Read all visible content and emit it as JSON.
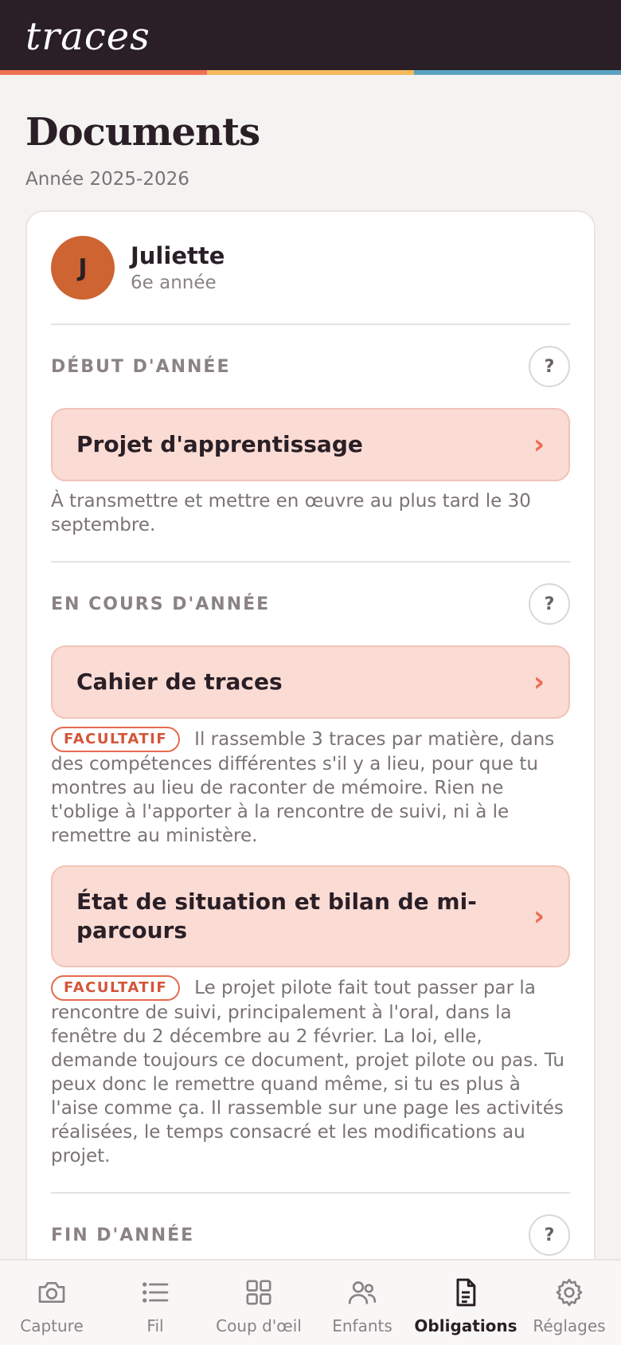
{
  "header": {
    "logo": "traces"
  },
  "page": {
    "title": "Documents",
    "subtitle": "Année 2025-2026"
  },
  "child": {
    "initial": "J",
    "name": "Juliette",
    "grade": "6e année"
  },
  "sections": [
    {
      "title": "DÉBUT D'ANNÉE",
      "items": [
        {
          "label": "Projet d'apprentissage",
          "badge": "",
          "description": "À transmettre et mettre en œuvre au plus tard le 30 septembre."
        }
      ]
    },
    {
      "title": "EN COURS D'ANNÉE",
      "items": [
        {
          "label": "Cahier de traces",
          "badge": "FACULTATIF",
          "description": "Il rassemble 3 traces par matière, dans des compétences différentes s'il y a lieu, pour que tu montres au lieu de raconter de mémoire. Rien ne t'oblige à l'apporter à la rencontre de suivi, ni à le remettre au ministère."
        },
        {
          "label": "État de situation et bilan de mi-parcours",
          "badge": "FACULTATIF",
          "description": "Le projet pilote fait tout passer par la rencontre de suivi, principalement à l'oral, dans la fenêtre du 2 décembre au 2 février. La loi, elle, demande toujours ce document, projet pilote ou pas. Tu peux donc le remettre quand même, si tu es plus à l'aise comme ça. Il rassemble sur une page les activités réalisées, le temps consacré et les modifications au projet."
        }
      ]
    },
    {
      "title": "FIN D'ANNÉE",
      "items": []
    }
  ],
  "help_label": "?",
  "tabs": [
    {
      "label": "Capture",
      "icon": "camera-icon",
      "active": false
    },
    {
      "label": "Fil",
      "icon": "list-icon",
      "active": false
    },
    {
      "label": "Coup d'œil",
      "icon": "grid-icon",
      "active": false
    },
    {
      "label": "Enfants",
      "icon": "people-icon",
      "active": false
    },
    {
      "label": "Obligations",
      "icon": "document-icon",
      "active": true
    },
    {
      "label": "Réglages",
      "icon": "gear-icon",
      "active": false
    }
  ],
  "colors": {
    "header_bg": "#2a1f26",
    "stripe": [
      "#f07155",
      "#f5b95a",
      "#5aa3c0"
    ],
    "accent": "#ee6a4f",
    "doc_button_bg": "#fadcd5",
    "avatar": "#cd6431"
  }
}
